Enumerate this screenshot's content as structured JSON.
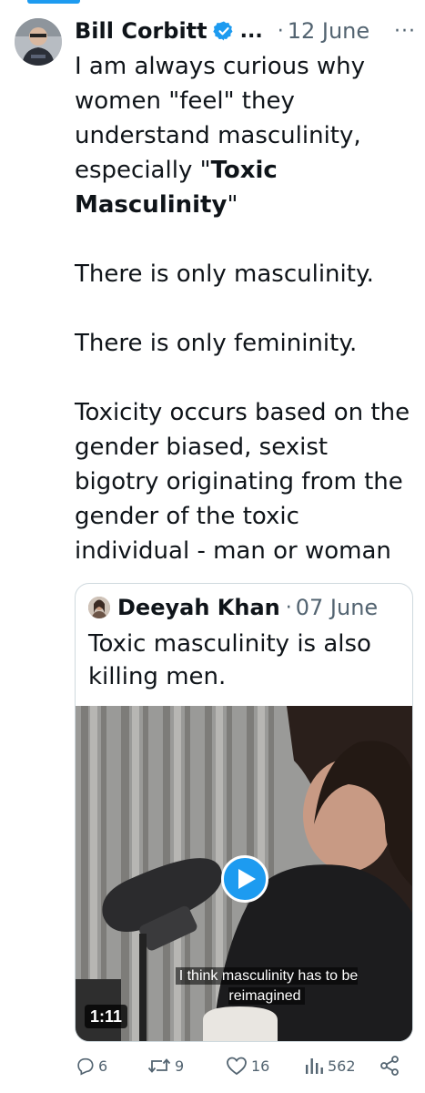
{
  "tweet": {
    "author": "Bill Corbitt",
    "handle_truncated": "...",
    "separator": "·",
    "date": "12 June",
    "more_menu": "···",
    "body_intro": "I am always curious why women \"feel\" they understand masculinity, especially \"",
    "body_bold": "Toxic Masculinity",
    "body_rest": "\"\n\nThere is only masculinity.\n\nThere is only femininity.\n\nToxicity occurs based on the gender biased, sexist bigotry originating from the gender of the toxic individual - man or woman"
  },
  "quote": {
    "author": "Deeyah Khan",
    "separator": "·",
    "date": "07 June",
    "text": "Toxic masculinity is also killing men.",
    "video": {
      "caption": "I think masculinity has to be\nreimagined",
      "duration": "1:11"
    }
  },
  "actions": {
    "replies": "6",
    "reposts": "9",
    "likes": "16",
    "views": "562"
  },
  "colors": {
    "accent": "#1d9bf0",
    "text": "#0f1419",
    "muted": "#536471",
    "border": "#cfd9de"
  },
  "icons": [
    "verified-badge-icon",
    "reply-icon",
    "repost-icon",
    "like-icon",
    "views-icon",
    "share-icon",
    "play-icon"
  ]
}
